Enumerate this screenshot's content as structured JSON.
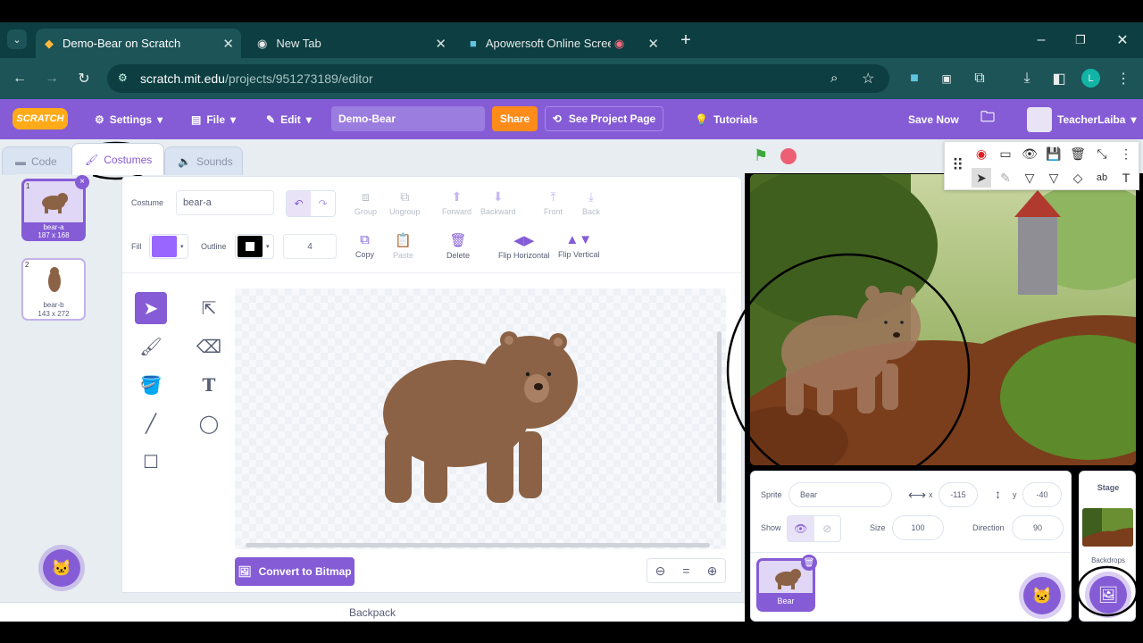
{
  "browser": {
    "tabs": [
      {
        "title": "Demo-Bear on Scratch",
        "active": true
      },
      {
        "title": "New Tab",
        "active": false
      },
      {
        "title": "Apowersoft Online Screen R",
        "active": false
      }
    ],
    "url_host": "scratch.mit.edu",
    "url_path": "/projects/951273189/editor",
    "profile_initial": "L"
  },
  "menubar": {
    "logo": "SCRATCH",
    "settings": "Settings",
    "file": "File",
    "edit": "Edit",
    "project_title": "Demo-Bear",
    "share": "Share",
    "see_project": "See Project Page",
    "tutorials": "Tutorials",
    "save_now": "Save Now",
    "username": "TeacherLaiba"
  },
  "editor_tabs": {
    "code": "Code",
    "costumes": "Costumes",
    "sounds": "Sounds"
  },
  "costumes": [
    {
      "index": "1",
      "name": "bear-a",
      "size": "187 x 168"
    },
    {
      "index": "2",
      "name": "bear-b",
      "size": "143 x 272"
    }
  ],
  "paint": {
    "costume_label": "Costume",
    "costume_name": "bear-a",
    "group": "Group",
    "ungroup": "Ungroup",
    "forward": "Forward",
    "backward": "Backward",
    "front": "Front",
    "back": "Back",
    "fill_label": "Fill",
    "outline_label": "Outline",
    "outline_width": "4",
    "copy": "Copy",
    "paste": "Paste",
    "delete": "Delete",
    "flip_h": "Flip Horizontal",
    "flip_v": "Flip Vertical",
    "convert": "Convert to Bitmap",
    "fill_color": "#9966ff",
    "outline_color": "#000000"
  },
  "backpack": "Backpack",
  "sprite_info": {
    "sprite_label": "Sprite",
    "sprite_name": "Bear",
    "x_label": "x",
    "x": "-115",
    "y_label": "y",
    "y": "-40",
    "show_label": "Show",
    "size_label": "Size",
    "size": "100",
    "direction_label": "Direction",
    "direction": "90",
    "sprite_tile": "Bear"
  },
  "stage_pane": {
    "title": "Stage",
    "backdrops": "Backdrops"
  },
  "colors": {
    "accent": "#855cd6",
    "share": "#ff8c1a",
    "tab_bg": "#0d3e41"
  }
}
